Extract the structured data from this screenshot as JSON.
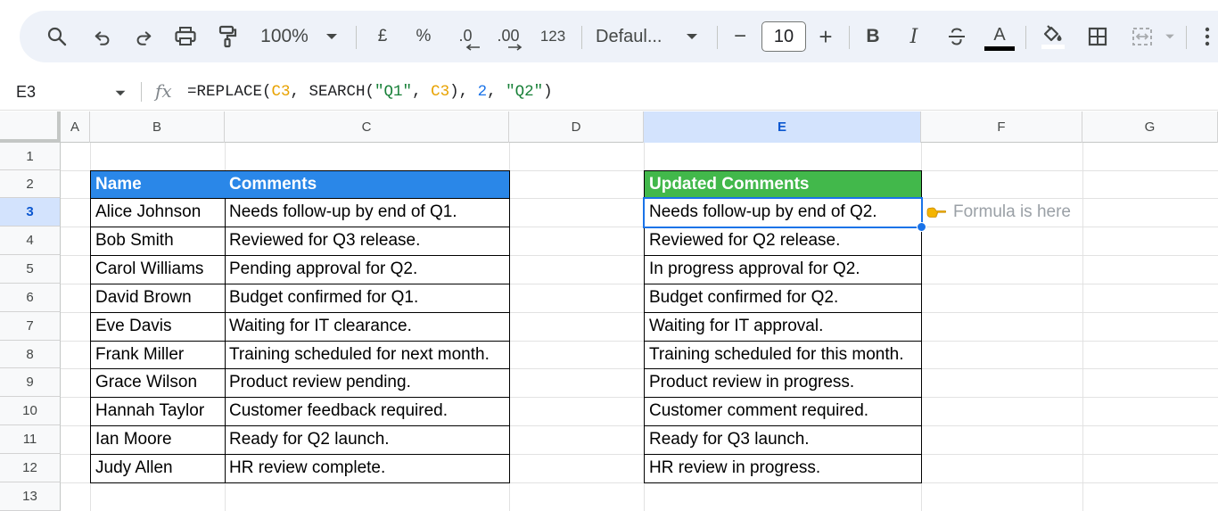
{
  "toolbar": {
    "zoom": "100%",
    "currency": "£",
    "percent": "%",
    "dec_decrease": ".0",
    "dec_increase": ".00",
    "number_format": "123",
    "font_name": "Defaul...",
    "font_size": "10",
    "minus": "−",
    "plus": "+",
    "bold": "B",
    "italic": "I",
    "text_color_letter": "A"
  },
  "formula_bar": {
    "name_box": "E3",
    "fx": "fx",
    "formula": {
      "p1": "=REPLACE(",
      "ref1": "C3",
      "p2": ", SEARCH(",
      "str1": "\"Q1\"",
      "p3": ", ",
      "ref2": "C3",
      "p4": "), ",
      "num1": "2",
      "p5": ", ",
      "str2": "\"Q2\"",
      "p6": ")"
    }
  },
  "columns": [
    "A",
    "B",
    "C",
    "D",
    "E",
    "F",
    "G"
  ],
  "rows": [
    "1",
    "2",
    "3",
    "4",
    "5",
    "6",
    "7",
    "8",
    "9",
    "10",
    "11",
    "12",
    "13"
  ],
  "active_cell": "E3",
  "colors": {
    "header_blue": "#2a87e8",
    "header_green": "#42b84b",
    "selection": "#1a73e8",
    "formula_ref": "#e8a200",
    "formula_string": "#188038"
  },
  "table_left": {
    "headers": [
      "Name",
      "Comments"
    ],
    "rows": [
      [
        "Alice Johnson",
        "Needs follow-up by end of Q1."
      ],
      [
        "Bob Smith",
        "Reviewed for Q3 release."
      ],
      [
        "Carol Williams",
        "Pending approval for Q2."
      ],
      [
        "David Brown",
        "Budget confirmed for Q1."
      ],
      [
        "Eve Davis",
        "Waiting for IT clearance."
      ],
      [
        "Frank Miller",
        "Training scheduled for next month."
      ],
      [
        "Grace Wilson",
        "Product review pending."
      ],
      [
        "Hannah Taylor",
        "Customer feedback required."
      ],
      [
        "Ian Moore",
        "Ready for Q2 launch."
      ],
      [
        "Judy Allen",
        "HR review complete."
      ]
    ]
  },
  "table_right": {
    "header": "Updated Comments",
    "rows": [
      "Needs follow-up by end of Q2.",
      "Reviewed for Q2 release.",
      "In progress approval for Q2.",
      "Budget confirmed for Q2.",
      "Waiting for IT approval.",
      "Training scheduled for this month.",
      "Product review in progress.",
      "Customer comment required.",
      "Ready for Q3 launch.",
      "HR review in progress."
    ]
  },
  "annotation": {
    "text": "Formula is here",
    "icon": "pointing-hand-icon"
  }
}
